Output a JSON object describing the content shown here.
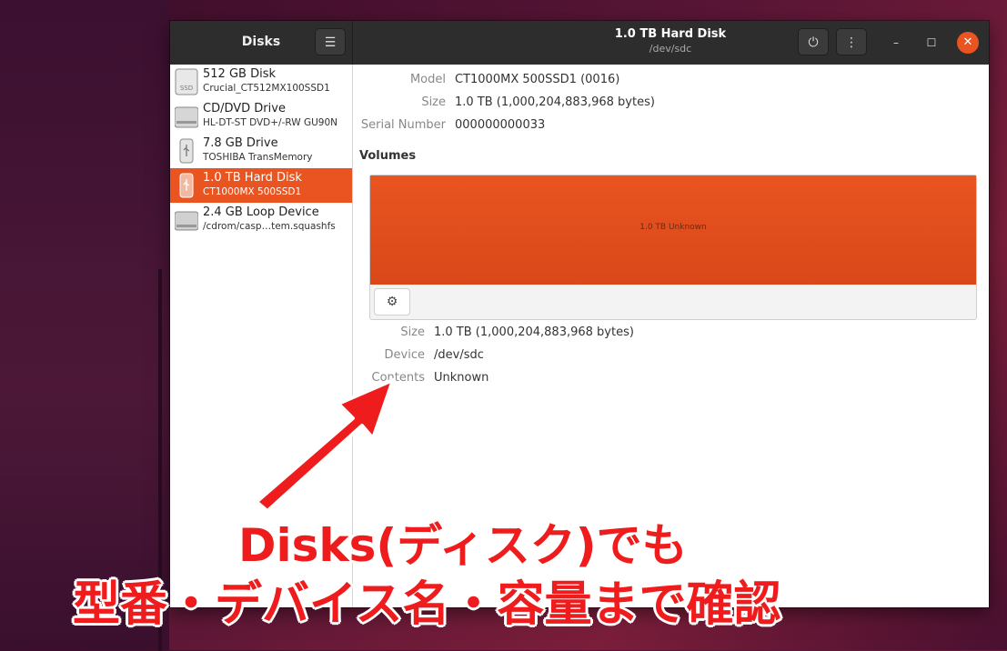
{
  "sidebar_title": "Disks",
  "window_title": "1.0 TB Hard Disk",
  "window_subtitle": "/dev/sdc",
  "icons": {
    "menu": "☰",
    "power": "⏻",
    "more": "⋮",
    "minimize": "–",
    "maximize": "☐",
    "close": "✕",
    "gear": "⚙"
  },
  "disks": [
    {
      "name": "512 GB Disk",
      "sub": "Crucial_CT512MX100SSD1",
      "icon": "ssd-icon",
      "selected": false
    },
    {
      "name": "CD/DVD Drive",
      "sub": "HL-DT-ST DVD+/-RW GU90N",
      "icon": "optical-drive-icon",
      "selected": false
    },
    {
      "name": "7.8 GB Drive",
      "sub": "TOSHIBA TransMemory",
      "icon": "usb-drive-icon",
      "selected": false
    },
    {
      "name": "1.0 TB Hard Disk",
      "sub": "CT1000MX 500SSD1",
      "icon": "usb-drive-icon",
      "selected": true
    },
    {
      "name": "2.4 GB Loop Device",
      "sub": "/cdrom/casp…tem.squashfs",
      "icon": "loop-device-icon",
      "selected": false
    }
  ],
  "drive_info": {
    "model_label": "Model",
    "model_value": "CT1000MX 500SSD1 (0016)",
    "size_label": "Size",
    "size_value": "1.0 TB (1,000,204,883,968 bytes)",
    "serial_label": "Serial Number",
    "serial_value": "000000000033"
  },
  "volumes": {
    "heading": "Volumes",
    "partition_label": "1.0 TB Unknown"
  },
  "volume_info": {
    "size_label": "Size",
    "size_value": "1.0 TB (1,000,204,883,968 bytes)",
    "device_label": "Device",
    "device_value": "/dev/sdc",
    "contents_label": "Contents",
    "contents_value": "Unknown"
  },
  "annotation": {
    "line1": "Disks(ディスク)でも",
    "line2": "型番・デバイス名・容量まで確認"
  },
  "colors": {
    "accent": "#e95420",
    "annotation": "#ee1c1c"
  }
}
